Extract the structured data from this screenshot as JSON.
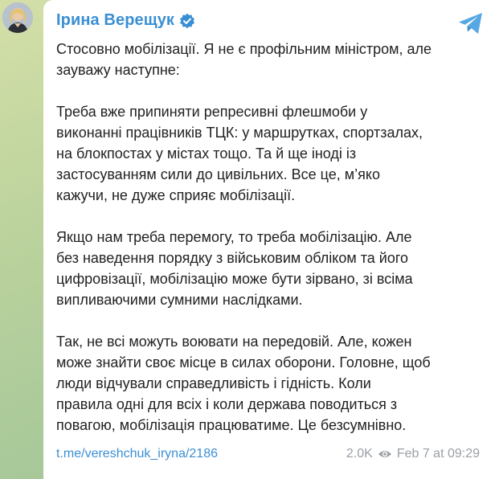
{
  "post": {
    "author": "Ірина Верещук",
    "paragraphs": [
      "Стосовно мобілізації. Я не є профільним міністром, але\nзауважу наступне:",
      "Треба вже припиняти репресивні флешмоби у\nвиконанні працівників ТЦК: у маршрутках, спортзалах,\nна блокпостах у містах тощо. Та й ще іноді із\nзастосуванням сили до цивільних. Все це, м’яко\nкажучи, не дуже сприяє мобілізації.",
      "Якщо нам треба перемогу, то треба мобілізацію. Але\nбез наведення порядку з військовим обліком та його\nцифровізації, мобілізацію може бути зірвано, зі всіма\nвипливаючими сумними наслідками.",
      "Так, не всі можуть воювати на передовій. Але, кожен\nможе знайти своє місце в силах оборони. Головне, щоб\nлюди відчували справедливість і гідність. Коли\nправила одні для всіх і коли держава поводиться з\nповагою, мобілізація працюватиме. Це безсумнівно."
    ],
    "link": "t.me/vereshchuk_iryna/2186",
    "views": "2.0K",
    "timestamp": "Feb 7 at 09:29"
  },
  "icons": {
    "verified": "verified-badge-icon",
    "share": "telegram-share-icon",
    "views": "eye-icon"
  },
  "colors": {
    "accent": "#3a8fd4",
    "text": "#222222",
    "meta": "#9aa0a6",
    "background": "#bcd39d"
  }
}
